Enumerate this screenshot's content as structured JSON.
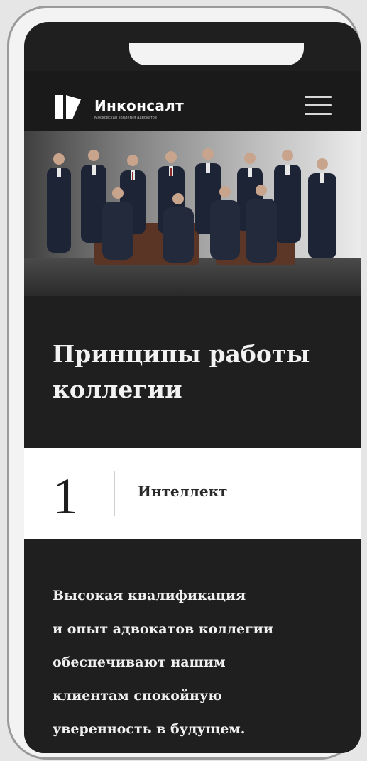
{
  "header": {
    "brand_name": "Инконсалт",
    "tagline": "Московская коллегия адвокатов",
    "logo_icon": "inconsult-logo-icon",
    "menu_icon": "hamburger-menu-icon"
  },
  "hero": {
    "image": "team-group-photo"
  },
  "main": {
    "title": "Принципы работы коллегии",
    "principle": {
      "number": "1",
      "name": "Интеллект",
      "description": "Высокая квалификация\nи опыт адвокатов коллегии\nобеспечивают нашим\nклиентам спокойную\nуверенность в будущем."
    }
  },
  "colors": {
    "dark_background": "#1f1f1f",
    "light_band": "#ffffff",
    "text_light": "#f0f0f0",
    "text_dark": "#1e1e1e"
  }
}
